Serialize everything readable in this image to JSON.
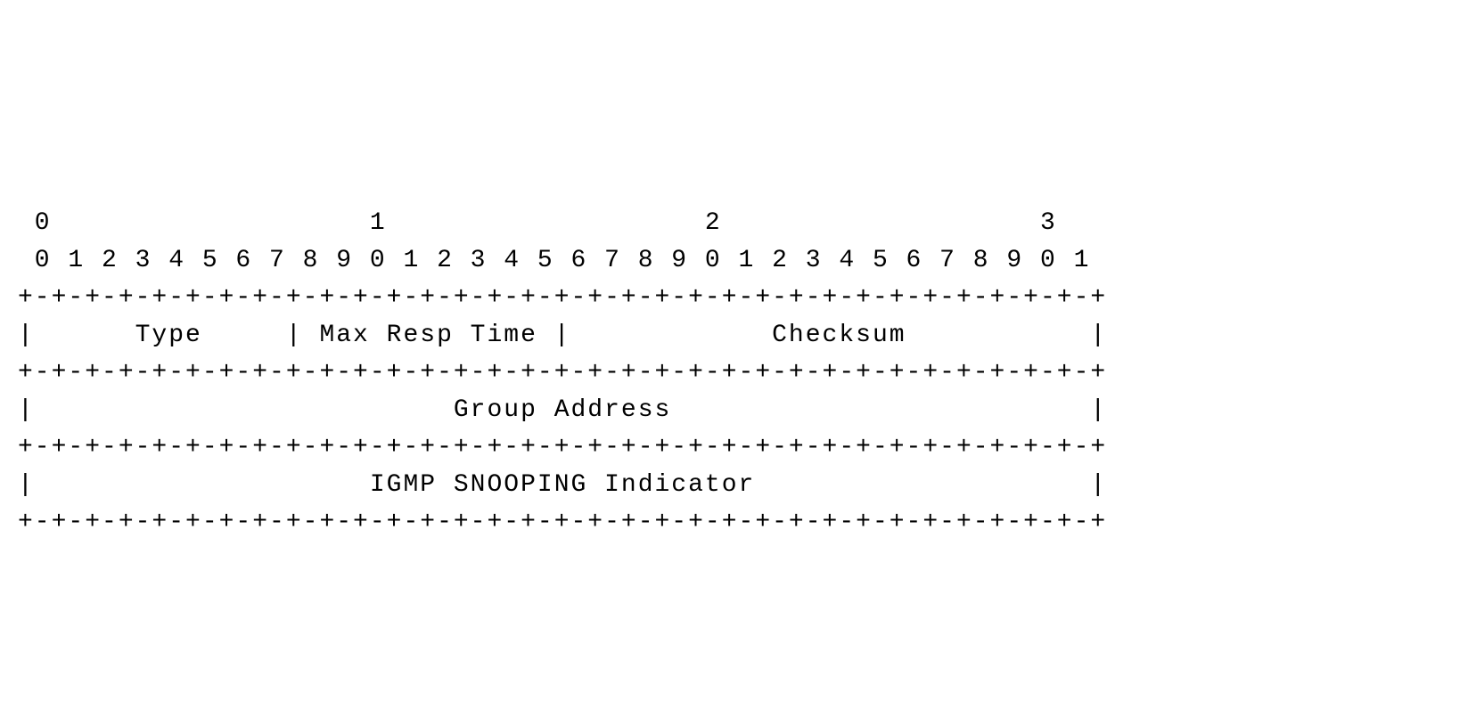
{
  "diagram": {
    "bit_ruler_tens": " 0                   1                   2                   3",
    "bit_ruler_units": " 0 1 2 3 4 5 6 7 8 9 0 1 2 3 4 5 6 7 8 9 0 1 2 3 4 5 6 7 8 9 0 1",
    "border": "+-+-+-+-+-+-+-+-+-+-+-+-+-+-+-+-+-+-+-+-+-+-+-+-+-+-+-+-+-+-+-+-+",
    "row1": "|      Type     | Max Resp Time |            Checksum           |",
    "row2": "|                         Group Address                         |",
    "row3": "|                    IGMP SNOOPING Indicator                    |"
  },
  "fields": {
    "type": {
      "label": "Type",
      "bits_start": 0,
      "bits_end": 7
    },
    "max_resp_time": {
      "label": "Max Resp Time",
      "bits_start": 8,
      "bits_end": 15
    },
    "checksum": {
      "label": "Checksum",
      "bits_start": 16,
      "bits_end": 31
    },
    "group_address": {
      "label": "Group Address",
      "bits_start": 0,
      "bits_end": 31
    },
    "igmp_snooping": {
      "label": "IGMP SNOOPING Indicator",
      "bits_start": 0,
      "bits_end": 31
    }
  }
}
